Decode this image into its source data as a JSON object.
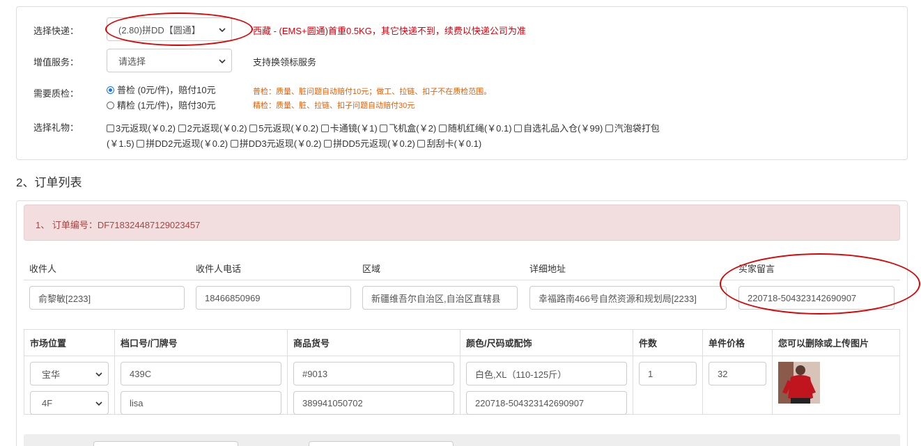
{
  "form": {
    "express_label": "选择快递：",
    "express_value": "(2.80)拼DD【圆通】",
    "express_note": "西藏 - (EMS+圆通)首重0.5KG，其它快递不到，续费以快递公司为准",
    "service_label": "增值服务：",
    "service_value": "请选择",
    "service_note": "支持换领标服务",
    "qc_label": "需要质检：",
    "qc_options": [
      {
        "label": "普检 (0元/件)，赔付10元",
        "note": "普检：质量、脏问题自动赔付10元；做工、拉链、扣子不在质检范围。",
        "checked": true
      },
      {
        "label": "精检 (1元/件)，赔付30元",
        "note": "精检：质量、脏、拉链、扣子问题自动赔付30元",
        "checked": false
      }
    ],
    "gift_label": "选择礼物：",
    "gifts_row1": [
      "3元返现(￥0.2)",
      "2元返现(￥0.2)",
      "5元返现(￥0.2)",
      "卡通镜(￥1)",
      "飞机盒(￥2)",
      "随机红绳(￥0.1)",
      "自选礼品入仓(￥99)",
      "汽泡袋打包"
    ],
    "gifts_row2_prefix": "(￥1.5)",
    "gifts_row2": [
      "拼DD2元返现(￥0.2)",
      "拼DD3元返现(￥0.2)",
      "拼DD5元返现(￥0.2)",
      "刮刮卡(￥0.1)"
    ]
  },
  "section_title": "2、订单列表",
  "order": {
    "header": "1、 订单编号：DF718324487129023457",
    "columns": [
      "收件人",
      "收件人电话",
      "区域",
      "详细地址",
      "买家留言"
    ],
    "values": [
      "俞黎敏[2233]",
      "18466850969",
      "新疆维吾尔自治区,自治区直辖县",
      "幸福路南466号自然资源和规划局[2233]",
      "220718-504323142690907"
    ]
  },
  "items_table": {
    "headers": [
      "市场位置",
      "档口号/门牌号",
      "商品货号",
      "颜色/尺码或配饰",
      "件数",
      "单件价格",
      "您可以删除或上传图片"
    ],
    "row": {
      "market": "宝华",
      "floor": "4F",
      "stall": "439C",
      "stall2": "lisa",
      "sku": "#9013",
      "sku2": "389941050702",
      "spec": "白色,XL（110-125斤）",
      "spec2": "220718-504323142690907",
      "qty": "1",
      "price": "32"
    }
  },
  "colors": {
    "accent_red": "#d9000c",
    "alert_bg": "#f2dede",
    "alert_text": "#a94442",
    "annotation": "#e00000"
  }
}
